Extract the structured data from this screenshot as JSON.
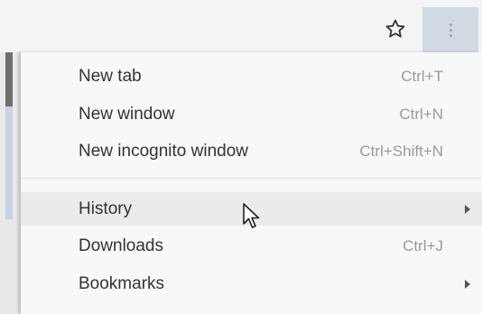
{
  "toolbar": {
    "star_icon": "star-outline-icon",
    "menu_icon": "vertical-dots-icon",
    "menu_button_bg": "#d2dae4"
  },
  "menu": {
    "items": [
      {
        "label": "New tab",
        "shortcut": "Ctrl+T"
      },
      {
        "label": "New window",
        "shortcut": "Ctrl+N"
      },
      {
        "label": "New incognito window",
        "shortcut": "Ctrl+Shift+N"
      },
      {
        "label": "History",
        "shortcut": "",
        "submenu": true,
        "hovered": true
      },
      {
        "label": "Downloads",
        "shortcut": "Ctrl+J"
      },
      {
        "label": "Bookmarks",
        "shortcut": "",
        "submenu": true
      }
    ]
  },
  "cursor_icon": "mouse-pointer-icon"
}
